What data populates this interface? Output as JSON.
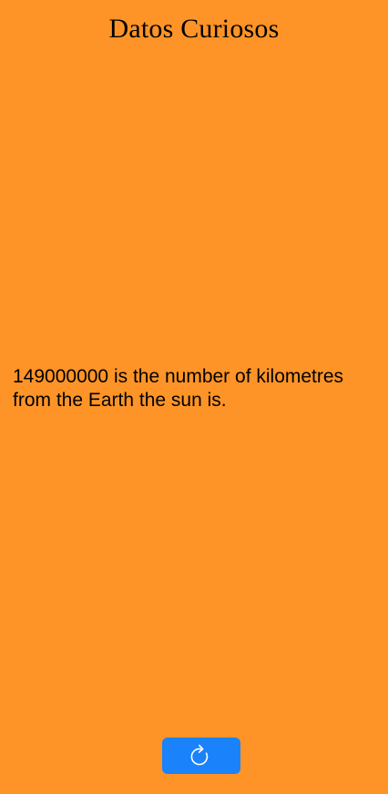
{
  "header": {
    "title": "Datos Curiosos"
  },
  "fact": {
    "text": "149000000 is the number of kilometres from the Earth the sun is."
  },
  "refresh_button": {
    "icon": "refresh-icon"
  },
  "colors": {
    "background": "#FE9427",
    "button": "#1A82FB",
    "icon": "#FFFFFF"
  }
}
